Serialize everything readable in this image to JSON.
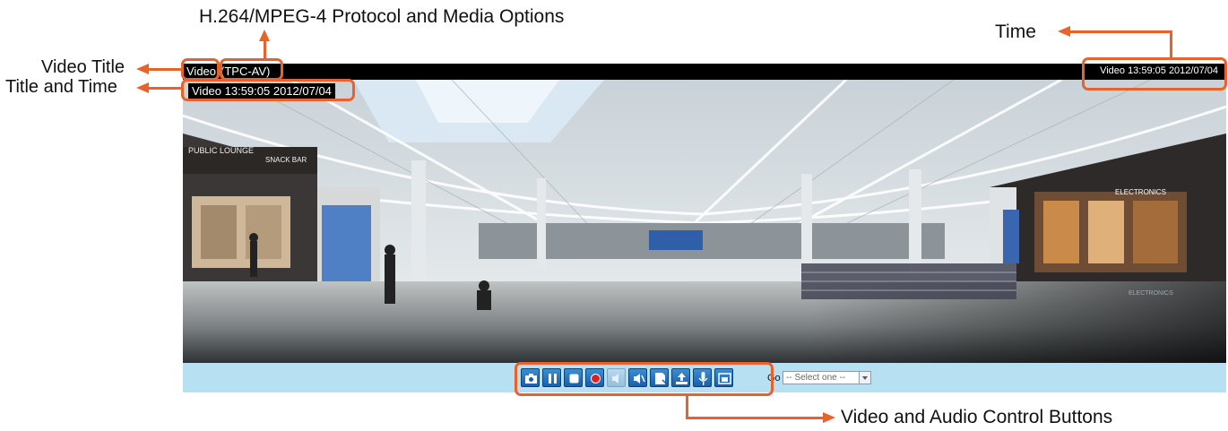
{
  "annotations": {
    "protocol": "H.264/MPEG-4 Protocol and Media Options",
    "time": "Time",
    "video_title": "Video Title",
    "title_and_time": "Title and Time",
    "controls": "Video and Audio Control Buttons"
  },
  "viewer": {
    "title": "Video",
    "protocol_tag": "(TPC-AV)",
    "top_time": "Video 13:59:05  2012/07/04",
    "overlay_text": "Video 13:59:05  2012/07/04"
  },
  "scene_signs": {
    "public_lounge": "PUBLIC LOUNGE",
    "snack_bar": "SNACK BAR",
    "electronics": "ELECTRONICS",
    "electronics_mirror": "ELECTRONICS"
  },
  "controls": {
    "buttons": [
      {
        "icon": "camera-icon",
        "label": "Snapshot"
      },
      {
        "icon": "pause-icon",
        "label": "Pause"
      },
      {
        "icon": "stop-icon",
        "label": "Stop"
      },
      {
        "icon": "record-icon",
        "label": "Record"
      },
      {
        "icon": "volume-icon",
        "label": "Volume"
      },
      {
        "icon": "mute-icon",
        "label": "Mute"
      },
      {
        "icon": "talk-icon",
        "label": "Talk"
      },
      {
        "icon": "upload-icon",
        "label": "Upload"
      },
      {
        "icon": "microphone-icon",
        "label": "Microphone"
      },
      {
        "icon": "fullscreen-icon",
        "label": "Full screen"
      }
    ],
    "goto_label": "Go to",
    "goto_selected": "-- Select one --"
  },
  "colors": {
    "annotation": "#e8632b",
    "control_bar": "#b8e0f3",
    "button_blue": "#1a5fae"
  }
}
